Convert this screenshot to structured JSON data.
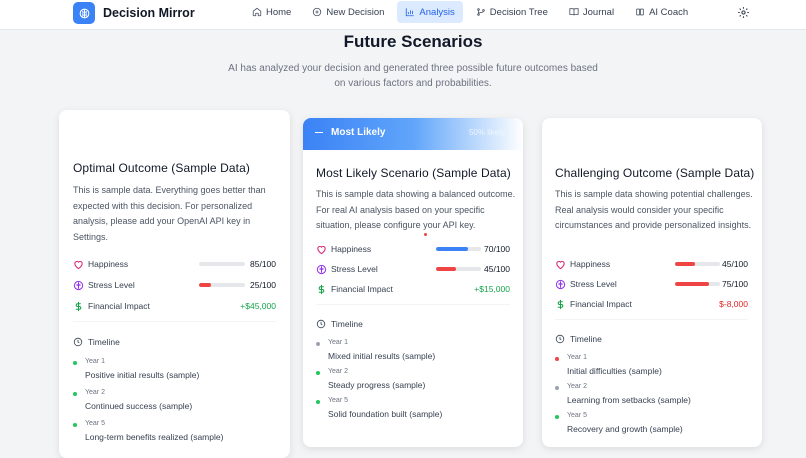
{
  "app": {
    "name": "Decision Mirror"
  },
  "nav": {
    "items": [
      {
        "label": "Home",
        "icon": "home-icon",
        "active": false
      },
      {
        "label": "New Decision",
        "icon": "plus-circle-icon",
        "active": false
      },
      {
        "label": "Analysis",
        "icon": "bar-chart-icon",
        "active": true
      },
      {
        "label": "Decision Tree",
        "icon": "git-branch-icon",
        "active": false
      },
      {
        "label": "Journal",
        "icon": "book-icon",
        "active": false
      },
      {
        "label": "AI Coach",
        "icon": "bot-icon",
        "active": false
      }
    ],
    "settings_icon": "gear-icon"
  },
  "hero": {
    "title": "Future Scenarios",
    "subtitle": "AI has analyzed your decision and generated three possible future outcomes based on various factors and probabilities."
  },
  "colors": {
    "accent": "#3b82f6",
    "happiness_icon": "#db2777",
    "stress_icon": "#9333ea",
    "finance_icon": "#16a34a",
    "bar_blue": "#3b82f6",
    "bar_red": "#ef4444",
    "dot_green": "#22c55e",
    "dot_gray": "#9ca3af",
    "dot_red": "#ef4444"
  },
  "scenarios": [
    {
      "title": "Optimal Outcome (Sample Data)",
      "description": "This is sample data. Everything goes better than expected with this decision. For personalized analysis, please add your OpenAI API key in Settings.",
      "metrics": {
        "happiness": {
          "label": "Happiness",
          "value": "85/100",
          "level": 0.85,
          "bar_color": "#e5e7eb"
        },
        "stress": {
          "label": "Stress Level",
          "value": "25/100",
          "level": 0.25,
          "bar_color": "#ef4444"
        },
        "financial": {
          "label": "Financial Impact",
          "value": "+$45,000"
        }
      },
      "timeline_label": "Timeline",
      "timeline": [
        {
          "year": "Year 1",
          "text": "Positive initial results (sample)",
          "dot": "#22c55e"
        },
        {
          "year": "Year 2",
          "text": "Continued success (sample)",
          "dot": "#22c55e"
        },
        {
          "year": "Year 5",
          "text": "Long-term benefits realized (sample)",
          "dot": "#22c55e"
        }
      ]
    },
    {
      "badge": "Most Likely",
      "probability": "50% likely",
      "title": "Most Likely Scenario (Sample Data)",
      "description": "This is sample data showing a balanced outcome. For real AI analysis based on your specific situation, please configure your API key.",
      "metrics": {
        "happiness": {
          "label": "Happiness",
          "value": "70/100",
          "level": 0.7,
          "bar_color": "#3b82f6"
        },
        "stress": {
          "label": "Stress Level",
          "value": "45/100",
          "level": 0.45,
          "bar_color": "#ef4444"
        },
        "financial": {
          "label": "Financial Impact",
          "value": "+$15,000"
        }
      },
      "timeline_label": "Timeline",
      "timeline": [
        {
          "year": "Year 1",
          "text": "Mixed initial results (sample)",
          "dot": "#9ca3af"
        },
        {
          "year": "Year 2",
          "text": "Steady progress (sample)",
          "dot": "#22c55e"
        },
        {
          "year": "Year 5",
          "text": "Solid foundation built (sample)",
          "dot": "#22c55e"
        }
      ]
    },
    {
      "title": "Challenging Outcome (Sample Data)",
      "description": "This is sample data showing potential challenges. Real analysis would consider your specific circumstances and provide personalized insights.",
      "metrics": {
        "happiness": {
          "label": "Happiness",
          "value": "45/100",
          "level": 0.45,
          "bar_color": "#ef4444"
        },
        "stress": {
          "label": "Stress Level",
          "value": "75/100",
          "level": 0.75,
          "bar_color": "#ef4444"
        },
        "financial": {
          "label": "Financial Impact",
          "value": "$-8,000"
        }
      },
      "timeline_label": "Timeline",
      "timeline": [
        {
          "year": "Year 1",
          "text": "Initial difficulties (sample)",
          "dot": "#ef4444"
        },
        {
          "year": "Year 2",
          "text": "Learning from setbacks (sample)",
          "dot": "#9ca3af"
        },
        {
          "year": "Year 5",
          "text": "Recovery and growth (sample)",
          "dot": "#22c55e"
        }
      ]
    }
  ]
}
